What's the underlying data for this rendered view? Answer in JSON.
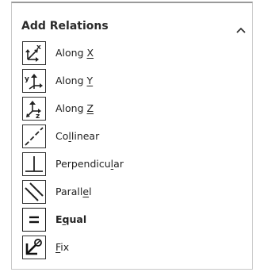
{
  "panel": {
    "title": "Add Relations",
    "collapse_icon": "chevron-up-icon"
  },
  "relations": [
    {
      "id": "along-x",
      "icon": "along-x-icon",
      "label": "Along X",
      "mnemonic_index": 6
    },
    {
      "id": "along-y",
      "icon": "along-y-icon",
      "label": "Along Y",
      "mnemonic_index": 6
    },
    {
      "id": "along-z",
      "icon": "along-z-icon",
      "label": "Along Z",
      "mnemonic_index": 6
    },
    {
      "id": "collinear",
      "icon": "collinear-icon",
      "label": "Collinear",
      "mnemonic_index": 2
    },
    {
      "id": "perpendicular",
      "icon": "perpendicular-icon",
      "label": "Perpendicular",
      "mnemonic_index": 10
    },
    {
      "id": "parallel",
      "icon": "parallel-icon",
      "label": "Parallel",
      "mnemonic_index": 6
    },
    {
      "id": "equal",
      "icon": "equal-icon",
      "label": "Equal",
      "mnemonic_index": 1,
      "bold": true
    },
    {
      "id": "fix",
      "icon": "fix-icon",
      "label": "Fix",
      "mnemonic_index": 0
    }
  ],
  "colors": {
    "text": "#222222",
    "border": "#c8c8c8",
    "icon_stroke": "#333333"
  }
}
